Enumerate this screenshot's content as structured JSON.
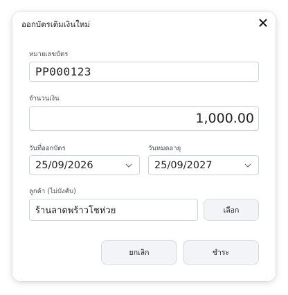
{
  "dialog": {
    "title": "ออกบัตรเติมเงินใหม่",
    "close_icon": "close-icon"
  },
  "form": {
    "card_number": {
      "label": "หมายเลขบัตร",
      "value": "PP000123"
    },
    "amount": {
      "label": "จำนวนเงิน",
      "value": "1,000.00"
    },
    "issue_date": {
      "label": "วันที่ออกบัตร",
      "value": "25/09/2026"
    },
    "expiry_date": {
      "label": "วันหมดอายุ",
      "value": "25/09/2027"
    },
    "customer": {
      "label": "ลูกค้า (ไม่บังคับ)",
      "value": "ร้านลาดพร้าวโชห่วย",
      "choose_label": "เลือก"
    }
  },
  "actions": {
    "cancel_label": "ยกเลิก",
    "pay_label": "ชำระ"
  }
}
